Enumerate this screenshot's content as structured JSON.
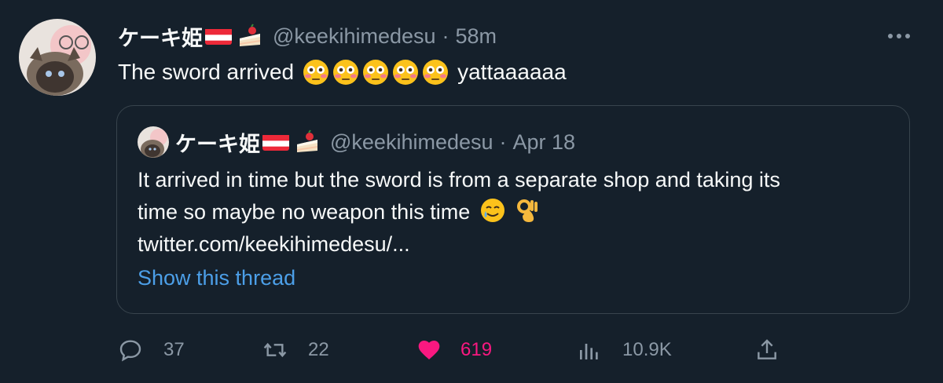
{
  "tweet": {
    "author": {
      "display_name": "ケーキ姫",
      "handle": "@keekihimedesu",
      "time": "58m",
      "avatar_icon": "avatar-cat-anime-icon",
      "flag_icon": "austria-flag-icon",
      "cake_icon": "shortcake-icon"
    },
    "dot": "·",
    "text_before": "The sword arrived",
    "text_emoji_icon": "flushed-face-icon",
    "text_emoji_count": 5,
    "text_after": "yattaaaaaa",
    "more_icon": "more-horizontal-icon"
  },
  "quote": {
    "author": {
      "display_name": "ケーキ姫",
      "handle": "@keekihimedesu",
      "time": "Apr 18"
    },
    "line1": "It arrived in time but the sword is from a separate shop and taking its",
    "line2": "time so maybe no weapon this time",
    "line2_emojis": [
      "smiling-face-with-tear-icon",
      "ok-hand-icon"
    ],
    "line3": "twitter.com/keekihimedesu/...",
    "show_thread": "Show this thread"
  },
  "actions": {
    "reply_count": "37",
    "retweet_count": "22",
    "like_count": "619",
    "views_count": "10.9K"
  },
  "colors": {
    "background": "#15202b",
    "text": "#f7f9f9",
    "muted": "#8b98a5",
    "link": "#4c9fe8",
    "like": "#f91880",
    "border": "#38444d"
  }
}
